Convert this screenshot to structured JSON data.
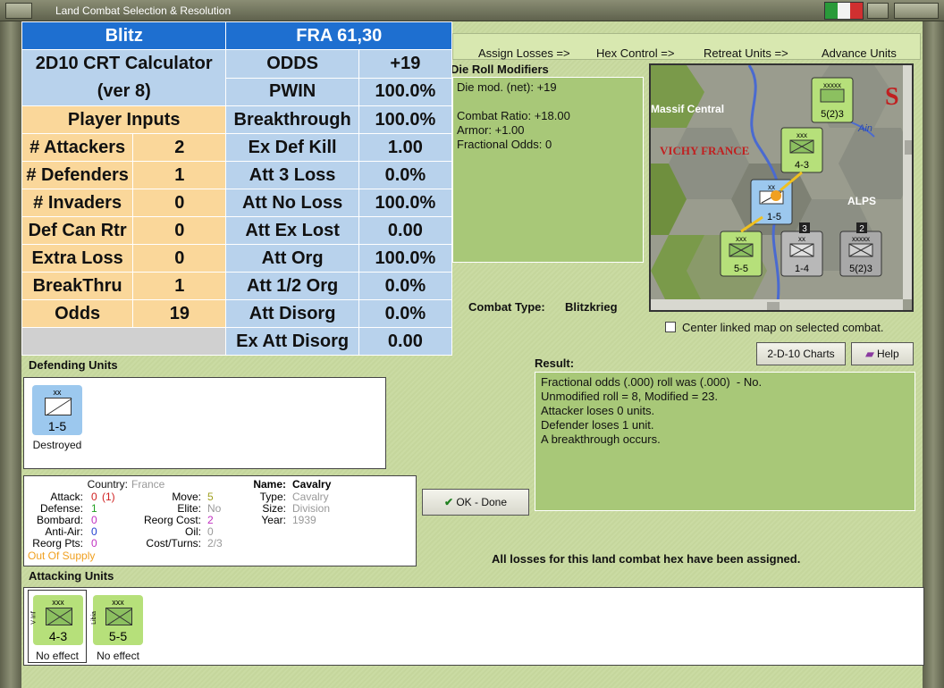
{
  "window": {
    "title": "Land Combat Selection & Resolution"
  },
  "calculator": {
    "header_left": "Blitz",
    "header_right": "FRA 61,30",
    "title_line1": "2D10 CRT Calculator",
    "title_line2": "(ver 8)",
    "player_inputs_label": "Player Inputs",
    "inputs": [
      {
        "label": "# Attackers",
        "value": "2"
      },
      {
        "label": "# Defenders",
        "value": "1"
      },
      {
        "label": "# Invaders",
        "value": "0"
      },
      {
        "label": "Def Can Rtr",
        "value": "0"
      },
      {
        "label": "Extra Loss",
        "value": "0"
      },
      {
        "label": "BreakThru",
        "value": "1"
      },
      {
        "label": "Odds",
        "value": "19"
      }
    ],
    "outputs": [
      {
        "label": "ODDS",
        "value": "+19"
      },
      {
        "label": "PWIN",
        "value": "100.0%"
      },
      {
        "label": "Breakthrough",
        "value": "100.0%"
      },
      {
        "label": "Ex Def Kill",
        "value": "1.00"
      },
      {
        "label": "Att 3 Loss",
        "value": "0.0%"
      },
      {
        "label": "Att No Loss",
        "value": "100.0%"
      },
      {
        "label": "Att Ex Lost",
        "value": "0.00"
      },
      {
        "label": "Att Org",
        "value": "100.0%"
      },
      {
        "label": "Att 1/2 Org",
        "value": "0.0%"
      },
      {
        "label": "Att Disorg",
        "value": "0.0%"
      },
      {
        "label": "Ex Att Disorg",
        "value": "0.00"
      }
    ]
  },
  "commands": {
    "assign_losses": "Assign Losses =>",
    "hex_control": "Hex Control =>",
    "retreat_units": "Retreat Units =>",
    "advance_units": "Advance Units"
  },
  "modifiers": {
    "title": "Die Roll Modifiers",
    "line1": "Die mod. (net): +19",
    "line2": "Combat Ratio: +18.00",
    "line3": "Armor: +1.00",
    "line4": "Fractional Odds: 0"
  },
  "combat_type": {
    "label": "Combat Type:",
    "value": "Blitzkrieg"
  },
  "map": {
    "labels": {
      "massif": "Massif Central",
      "vichy": "VICHY FRANCE",
      "alps": "ALPS",
      "ain": "Ain",
      "s_mark": "S"
    },
    "units": [
      {
        "name": "5(2)3",
        "tag": "xxxxx"
      },
      {
        "name": "4-3",
        "tag": "xxx"
      },
      {
        "name": "1-5",
        "tag": "xx"
      },
      {
        "name": "5-5",
        "tag": "xxx"
      },
      {
        "name": "1-4",
        "tag": "xx"
      },
      {
        "name": "5(2)3",
        "tag": "xxxxx"
      }
    ],
    "badge_3": "3",
    "badge_2": "2",
    "center_linked_label": "Center linked map on selected combat."
  },
  "buttons": {
    "charts": "2-D-10 Charts",
    "help": "Help",
    "ok": "OK - Done"
  },
  "result": {
    "title": "Result:",
    "line1": "Fractional odds (.000) roll was (.000)  - No.",
    "line2": "Unmodified roll = 8, Modified = 23.",
    "line3": "Attacker loses 0 units.",
    "line4": "Defender loses 1 unit.",
    "line5": "A breakthrough occurs."
  },
  "defending": {
    "title": "Defending Units",
    "unit": {
      "tag": "xx",
      "strength": "1-5",
      "status": "Destroyed"
    }
  },
  "details": {
    "country_label": "Country:",
    "country": "France",
    "attack_label": "Attack:",
    "attack": "0",
    "attack_paren": "(1)",
    "defense_label": "Defense:",
    "defense": "1",
    "bombard_label": "Bombard:",
    "bombard": "0",
    "antiair_label": "Anti-Air:",
    "antiair": "0",
    "reorg_pts_label": "Reorg Pts:",
    "reorg_pts": "0",
    "supply": "Out Of Supply",
    "move_label": "Move:",
    "move": "5",
    "elite_label": "Elite:",
    "elite": "No",
    "reorg_cost_label": "Reorg Cost:",
    "reorg_cost": "2",
    "oil_label": "Oil:",
    "oil": "0",
    "cost_turns_label": "Cost/Turns:",
    "cost_turns": "2/3",
    "name_label": "Name:",
    "name": "Cavalry",
    "type_label": "Type:",
    "type": "Cavalry",
    "size_label": "Size:",
    "size": "Division",
    "year_label": "Year:",
    "year": "1939"
  },
  "status_message": "All losses for this land combat hex have been assigned.",
  "attacking": {
    "title": "Attacking Units",
    "units": [
      {
        "tag": "xxx",
        "side": "V Inf",
        "strength": "4-3",
        "status": "No effect"
      },
      {
        "tag": "xxx",
        "side": "Libia",
        "strength": "5-5",
        "status": "No effect"
      }
    ]
  },
  "colors": {
    "header_blue": "#1e6fd0",
    "cell_blue": "#b8d2ec",
    "cell_orange": "#fad79a",
    "panel_green": "#a8c878",
    "unit_green": "#b6e07a",
    "unit_blue": "#9cc8ee"
  }
}
